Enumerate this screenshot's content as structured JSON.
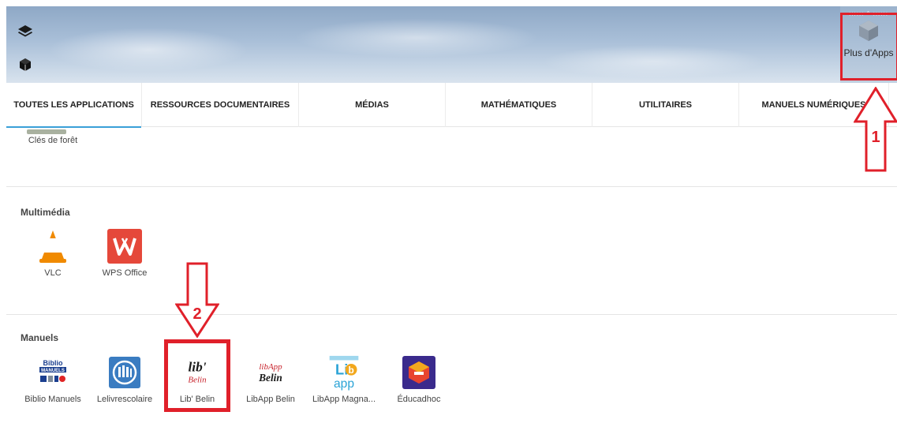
{
  "banner": {
    "icons": [
      "layers-icon",
      "cube-icon"
    ],
    "plus_apps": {
      "label": "Plus d'Apps",
      "icon": "cube-icon"
    }
  },
  "tabs": [
    {
      "label": "TOUTES LES APPLICATIONS",
      "active": true
    },
    {
      "label": "RESSOURCES DOCUMENTAIRES",
      "active": false
    },
    {
      "label": "MÉDIAS",
      "active": false
    },
    {
      "label": "MATHÉMATIQUES",
      "active": false
    },
    {
      "label": "UTILITAIRES",
      "active": false
    },
    {
      "label": "MANUELS NUMÉRIQUES",
      "active": false
    }
  ],
  "sections": [
    {
      "title": "",
      "apps": [
        {
          "name": "Clés de forêt"
        }
      ]
    },
    {
      "title": "Multimédia",
      "apps": [
        {
          "name": "VLC"
        },
        {
          "name": "WPS Office"
        }
      ]
    },
    {
      "title": "Manuels",
      "apps": [
        {
          "name": "Biblio Manuels"
        },
        {
          "name": "Lelivrescolaire"
        },
        {
          "name": "Lib' Belin"
        },
        {
          "name": "LibApp Belin"
        },
        {
          "name": "LibApp Magna..."
        },
        {
          "name": "Éducadhoc"
        }
      ]
    }
  ],
  "icon_text": {
    "biblio": [
      "Biblio",
      "MANUELS"
    ],
    "lib": [
      "lib'",
      "Belin"
    ],
    "libapp": [
      "libApp",
      "Belin"
    ],
    "libmagnard": [
      "Li",
      "b",
      "app"
    ]
  },
  "annotations": {
    "step1": "1",
    "step2": "2"
  },
  "colors": {
    "tab_underline": "#3aa0d8",
    "highlight_red": "#e0202a",
    "vlc_orange": "#f08a00",
    "wps_red": "#e5483a"
  }
}
